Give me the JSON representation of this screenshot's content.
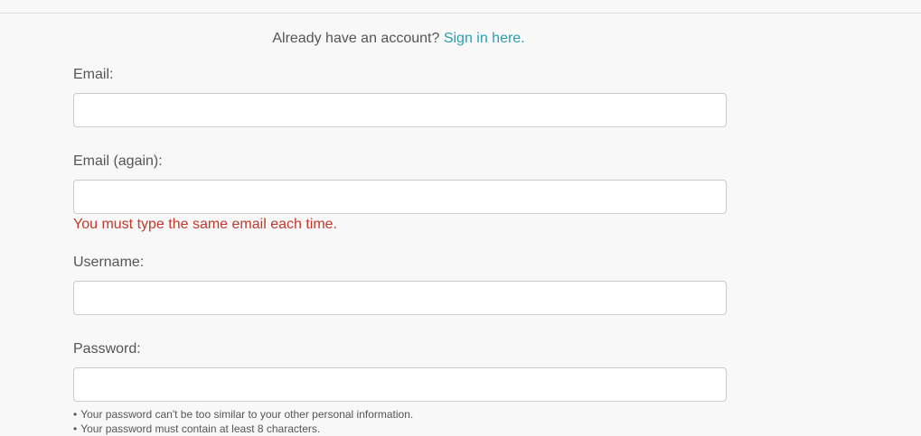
{
  "header": {
    "signin_prompt": "Already have an account?",
    "signin_link": "Sign in here",
    "signin_suffix": "."
  },
  "form": {
    "email": {
      "label": "Email:",
      "value": ""
    },
    "email_again": {
      "label": "Email (again):",
      "value": "",
      "error": "You must type the same email each time."
    },
    "username": {
      "label": "Username:",
      "value": ""
    },
    "password": {
      "label": "Password:",
      "value": "",
      "hints": [
        "Your password can't be too similar to your other personal information.",
        "Your password must contain at least 8 characters."
      ]
    }
  },
  "colors": {
    "link": "#2a9fb2",
    "error": "#c0392b",
    "background": "#f8f8f8"
  }
}
